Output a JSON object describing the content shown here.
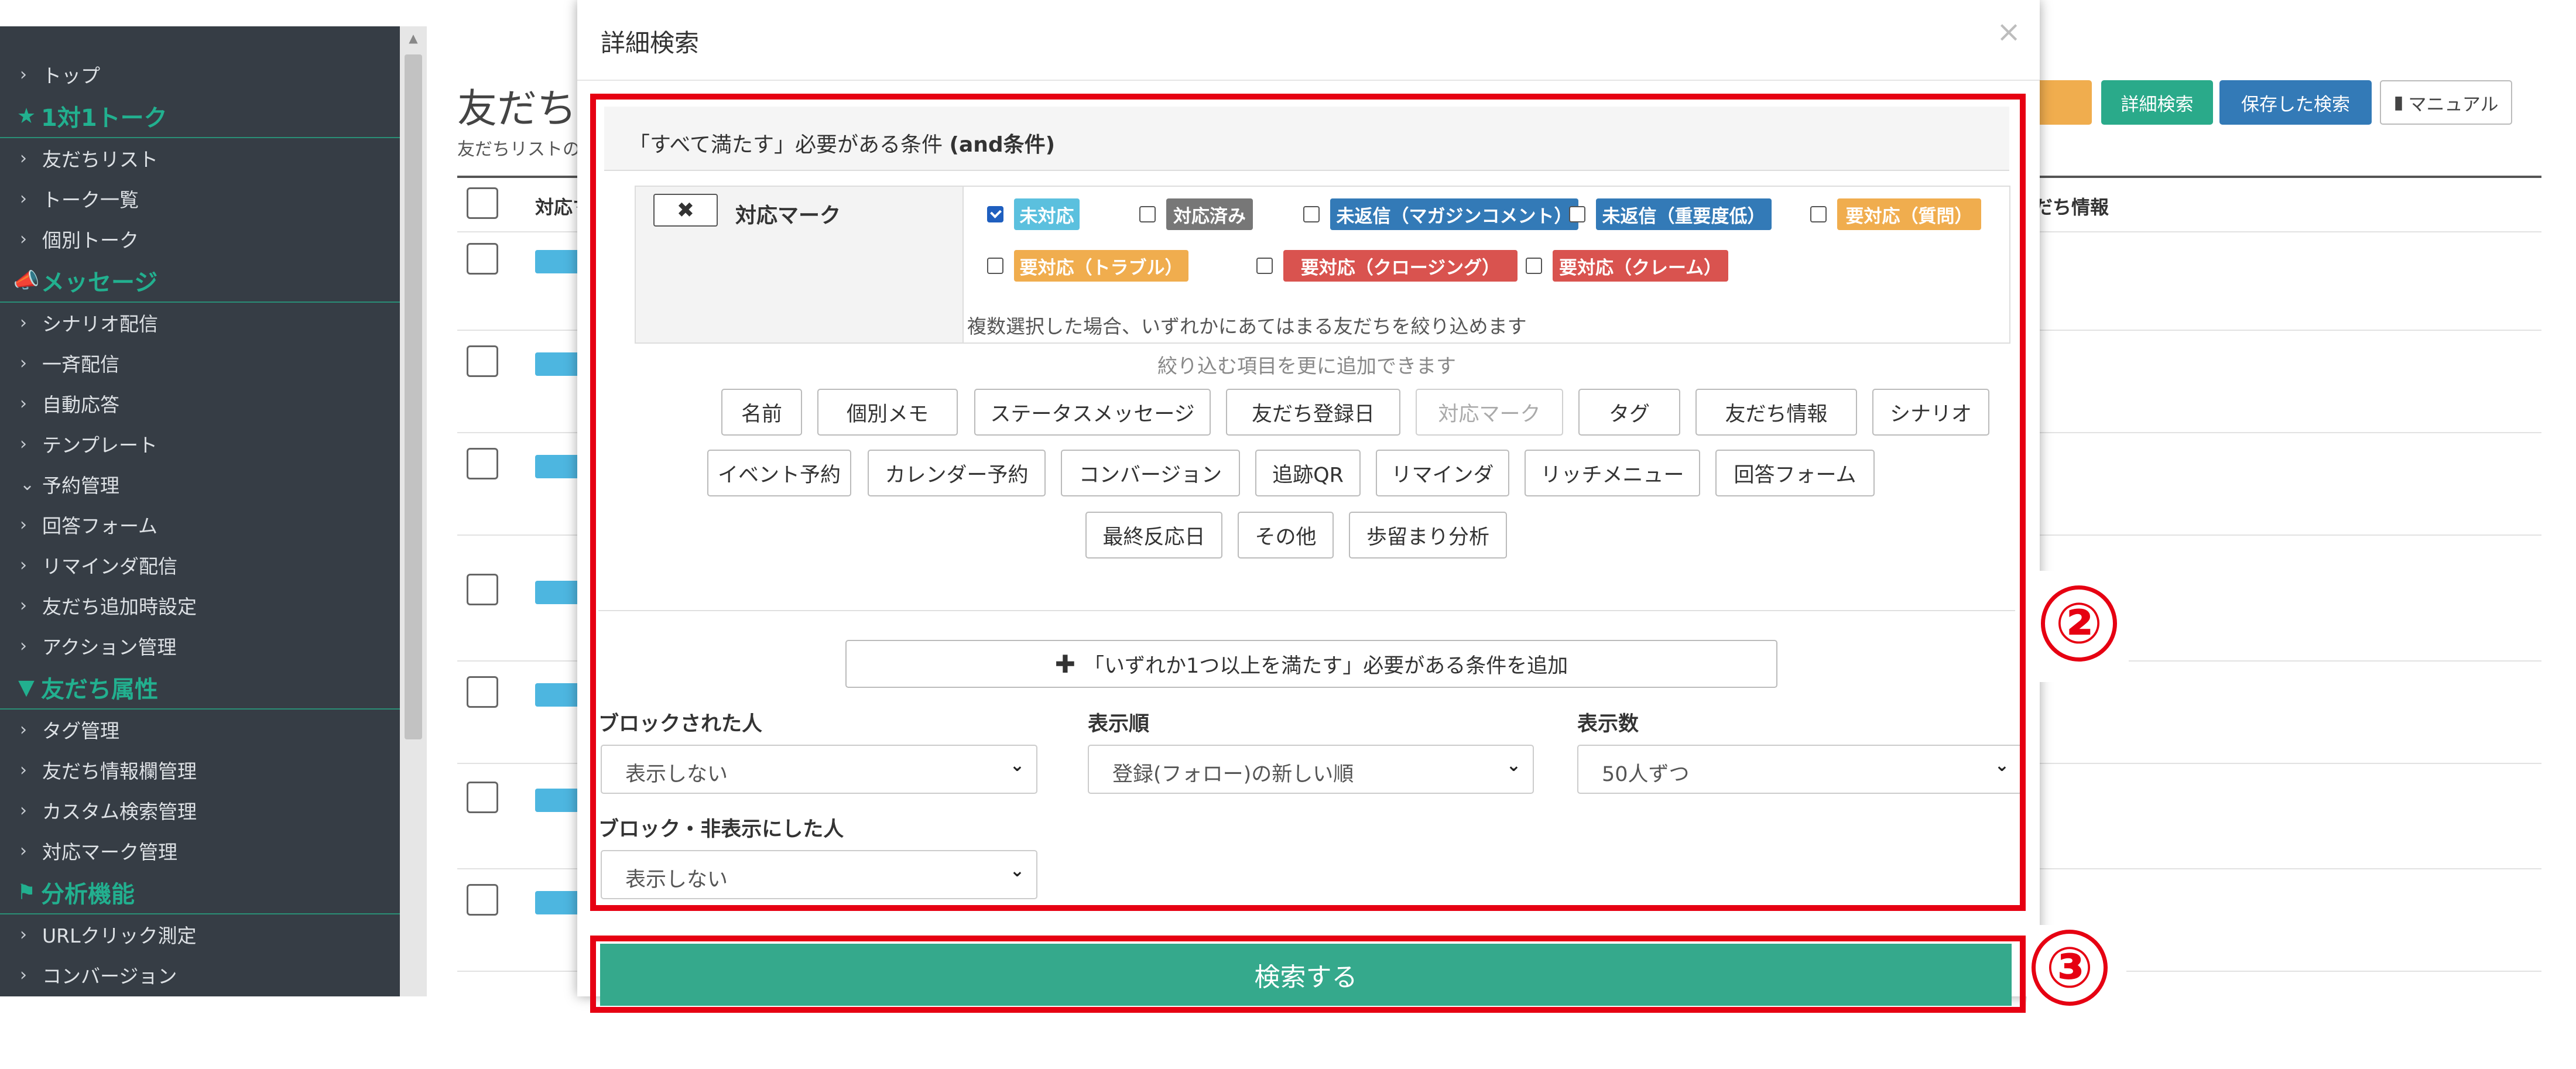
{
  "sidebar": {
    "entries": [
      {
        "type": "item",
        "label": "トップ"
      },
      {
        "type": "header",
        "label": "1対1トーク",
        "icon": "star-icon",
        "glyph": "★"
      },
      {
        "type": "item",
        "label": "友だちリスト"
      },
      {
        "type": "item",
        "label": "トーク一覧"
      },
      {
        "type": "item",
        "label": "個別トーク"
      },
      {
        "type": "header",
        "label": "メッセージ",
        "icon": "megaphone-icon",
        "glyph": "📣"
      },
      {
        "type": "item",
        "label": "シナリオ配信"
      },
      {
        "type": "item",
        "label": "一斉配信"
      },
      {
        "type": "item",
        "label": "自動応答"
      },
      {
        "type": "item",
        "label": "テンプレート"
      },
      {
        "type": "item",
        "label": "予約管理",
        "expanded": true
      },
      {
        "type": "item",
        "label": "回答フォーム"
      },
      {
        "type": "item",
        "label": "リマインダ配信"
      },
      {
        "type": "item",
        "label": "友だち追加時設定"
      },
      {
        "type": "item",
        "label": "アクション管理"
      },
      {
        "type": "header",
        "label": "友だち属性",
        "icon": "filter-icon",
        "glyph": "▼"
      },
      {
        "type": "item",
        "label": "タグ管理"
      },
      {
        "type": "item",
        "label": "友だち情報欄管理"
      },
      {
        "type": "item",
        "label": "カスタム検索管理"
      },
      {
        "type": "item",
        "label": "対応マーク管理"
      },
      {
        "type": "header",
        "label": "分析機能",
        "icon": "flag-icon",
        "glyph": "⚑"
      },
      {
        "type": "item",
        "label": "URLクリック測定"
      },
      {
        "type": "item",
        "label": "コンバージョン"
      }
    ]
  },
  "background": {
    "title": "友だち",
    "subtitle": "友だちリストの",
    "column_left": "対応マ",
    "column_right": "だち情報",
    "buttons": {
      "detail_search": "詳細検索",
      "saved_search": "保存した検索",
      "manual": "マニュアル"
    }
  },
  "modal": {
    "title": "詳細検索",
    "close_glyph": "×",
    "and_section": {
      "header_prefix": "「すべて満たす」必要がある条件 ",
      "header_bold": "(and条件)",
      "remove_glyph": "✖",
      "field_label": "対応マーク",
      "marks": [
        {
          "label": "未対応",
          "color": "#5bc0de",
          "checked": true
        },
        {
          "label": "対応済み",
          "color": "#777777",
          "checked": false
        },
        {
          "label": "未返信（マガジンコメント）",
          "color": "#337ab7",
          "checked": false
        },
        {
          "label": "未返信（重要度低）",
          "color": "#337ab7",
          "checked": false
        },
        {
          "label": "要対応（質問）",
          "color": "#f0ad4e",
          "checked": false
        },
        {
          "label": "要対応（トラブル）",
          "color": "#f0ad4e",
          "checked": false
        },
        {
          "label": "要対応（クロージング）",
          "color": "#d9534f",
          "checked": false
        },
        {
          "label": "要対応（クレーム）",
          "color": "#d9534f",
          "checked": false
        }
      ],
      "hint": "複数選択した場合、いずれかにあてはまる友だちを絞り込めます"
    },
    "add_hint": "絞り込む項目を更に追加できます",
    "filter_rows": [
      [
        {
          "label": "名前",
          "disabled": false
        },
        {
          "label": "個別メモ",
          "disabled": false
        },
        {
          "label": "ステータスメッセージ",
          "disabled": false
        },
        {
          "label": "友だち登録日",
          "disabled": false
        },
        {
          "label": "対応マーク",
          "disabled": true
        },
        {
          "label": "タグ",
          "disabled": false
        },
        {
          "label": "友だち情報",
          "disabled": false
        },
        {
          "label": "シナリオ",
          "disabled": false
        }
      ],
      [
        {
          "label": "イベント予約",
          "disabled": false
        },
        {
          "label": "カレンダー予約",
          "disabled": false
        },
        {
          "label": "コンバージョン",
          "disabled": false
        },
        {
          "label": "追跡QR",
          "disabled": false
        },
        {
          "label": "リマインダ",
          "disabled": false
        },
        {
          "label": "リッチメニュー",
          "disabled": false
        },
        {
          "label": "回答フォーム",
          "disabled": false
        }
      ],
      [
        {
          "label": "最終反応日",
          "disabled": false
        },
        {
          "label": "その他",
          "disabled": false
        },
        {
          "label": "歩留まり分析",
          "disabled": false
        }
      ]
    ],
    "or_condition_button": {
      "glyph": "✚",
      "label": "「いずれか1つ以上を満たす」必要がある条件を追加"
    },
    "fields": {
      "blocked": {
        "label": "ブロックされた人",
        "value": "表示しない"
      },
      "order": {
        "label": "表示順",
        "value": "登録(フォロー)の新しい順"
      },
      "count": {
        "label": "表示数",
        "value": "50人ずつ"
      },
      "hidden": {
        "label": "ブロック・非表示にした人",
        "value": "表示しない"
      }
    },
    "search_button": "検索する"
  },
  "annotations": {
    "marker_2": "②",
    "marker_3": "③",
    "highlight_color": "#e60012"
  }
}
